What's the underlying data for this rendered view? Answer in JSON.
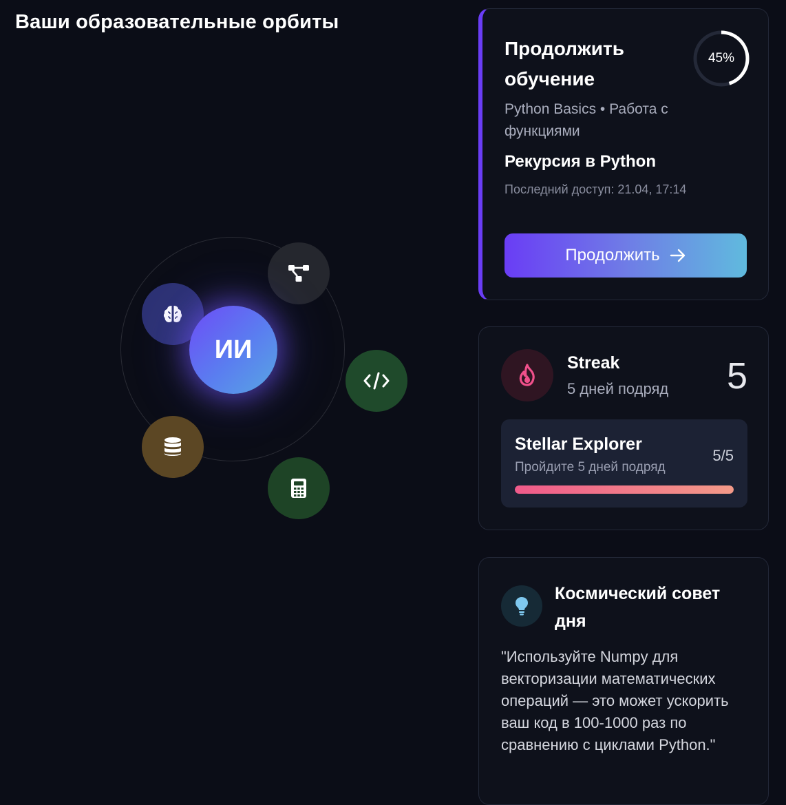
{
  "page": {
    "title": "Ваши образовательные орбиты"
  },
  "orbit": {
    "core_label": "ИИ",
    "planets": [
      {
        "icon": "brain-icon",
        "color": "#2d3274"
      },
      {
        "icon": "network-icon",
        "color": "#25272e"
      },
      {
        "icon": "code-icon",
        "color": "#1f4a2b"
      },
      {
        "icon": "database-icon",
        "color": "#5c4724"
      },
      {
        "icon": "calculator-icon",
        "color": "#1e4426"
      }
    ]
  },
  "continue_card": {
    "title": "Продолжить обучение",
    "progress_percent": 45,
    "progress_label": "45%",
    "course_path": "Python Basics • Работа с функциями",
    "lesson_title": "Рекурсия в Python",
    "last_access": "Последний доступ: 21.04, 17:14",
    "button_label": "Продолжить",
    "accent_color": "#6a3df5"
  },
  "streak_card": {
    "label": "Streak",
    "subtitle": "5 дней подряд",
    "count": "5",
    "achievement": {
      "title": "Stellar Explorer",
      "description": "Пройдите 5 дней подряд",
      "progress_label": "5/5",
      "progress_fraction": 1.0
    }
  },
  "tip_card": {
    "title": "Космический совет дня",
    "text": "\"Используйте Numpy для векторизации математических операций — это может ускорить ваш код в 100-1000 раз по сравнению с циклами Python.\""
  }
}
